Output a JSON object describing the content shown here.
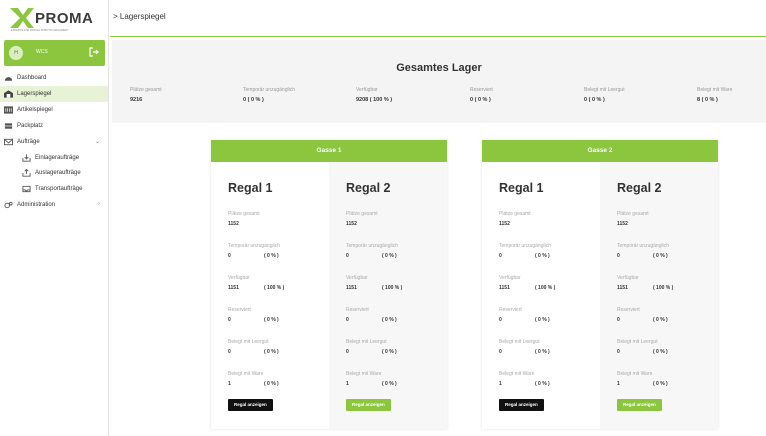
{
  "brand": {
    "logo_text": "XPROMA",
    "tagline": "EXPERTS FOR PARCEL ROBOTIC MACHINERY",
    "accent": "#8cc63f"
  },
  "user": {
    "avatar_initials": "H",
    "name": "WCS"
  },
  "nav": [
    {
      "label": "Dashboard",
      "icon": "dashboard-icon"
    },
    {
      "label": "Lagerspiegel",
      "icon": "warehouse-icon",
      "active": true
    },
    {
      "label": "Artikelspiegel",
      "icon": "barcode-icon"
    },
    {
      "label": "Packplatz",
      "icon": "box-icon"
    },
    {
      "label": "Aufträge",
      "icon": "mail-icon",
      "chevron": "⌄"
    },
    {
      "label": "Einlageraufträge",
      "icon": "inbox-in-icon",
      "sub": true
    },
    {
      "label": "Auslageraufträge",
      "icon": "inbox-out-icon",
      "sub": true
    },
    {
      "label": "Transportaufträge",
      "icon": "tray-icon",
      "sub": true
    },
    {
      "label": "Administration",
      "icon": "gears-icon",
      "chevron": "›"
    }
  ],
  "breadcrumb": "> Lagerspiegel",
  "summary": {
    "title": "Gesamtes Lager",
    "stats": [
      {
        "label": "Plätze gesamt",
        "value": "9216"
      },
      {
        "label": "Temporär unzugänglich",
        "value": "0  ( 0 % )"
      },
      {
        "label": "Verfügbar",
        "value": "9208  ( 100 % )"
      },
      {
        "label": "Reserviert",
        "value": "0  ( 0 % )"
      },
      {
        "label": "Belegt mit Leergut",
        "value": "0  ( 0 % )"
      },
      {
        "label": "Belegt mit Ware",
        "value": "8  ( 0 % )"
      }
    ]
  },
  "gassen": [
    {
      "title": "Gasse 1",
      "regale": [
        {
          "title": "Regal 1",
          "button": "Regal anzeigen",
          "fields": [
            {
              "label": "Plätze gesamt",
              "value": "1152",
              "pct": ""
            },
            {
              "label": "Temporär unzugänglich",
              "value": "0",
              "pct": "( 0 % )"
            },
            {
              "label": "Verfügbar",
              "value": "1151",
              "pct": "( 100 % )"
            },
            {
              "label": "Reserviert",
              "value": "0",
              "pct": "( 0 % )"
            },
            {
              "label": "Belegt mit Leergut",
              "value": "0",
              "pct": "( 0 % )"
            },
            {
              "label": "Belegt mit Ware",
              "value": "1",
              "pct": "( 0 % )"
            }
          ]
        },
        {
          "title": "Regal 2",
          "button": "Regal anzeigen",
          "fields": [
            {
              "label": "Plätze gesamt",
              "value": "1152",
              "pct": ""
            },
            {
              "label": "Temporär unzugänglich",
              "value": "0",
              "pct": "( 0 % )"
            },
            {
              "label": "Verfügbar",
              "value": "1151",
              "pct": "( 100 % )"
            },
            {
              "label": "Reserviert",
              "value": "0",
              "pct": "( 0 % )"
            },
            {
              "label": "Belegt mit Leergut",
              "value": "0",
              "pct": "( 0 % )"
            },
            {
              "label": "Belegt mit Ware",
              "value": "1",
              "pct": "( 0 % )"
            }
          ]
        }
      ]
    },
    {
      "title": "Gasse 2",
      "regale": [
        {
          "title": "Regal 1",
          "button": "Regal anzeigen",
          "fields": [
            {
              "label": "Plätze gesamt",
              "value": "1152",
              "pct": ""
            },
            {
              "label": "Temporär unzugänglich",
              "value": "0",
              "pct": "( 0 % )"
            },
            {
              "label": "Verfügbar",
              "value": "1151",
              "pct": "( 100 % )"
            },
            {
              "label": "Reserviert",
              "value": "0",
              "pct": "( 0 % )"
            },
            {
              "label": "Belegt mit Leergut",
              "value": "0",
              "pct": "( 0 % )"
            },
            {
              "label": "Belegt mit Ware",
              "value": "1",
              "pct": "( 0 % )"
            }
          ]
        },
        {
          "title": "Regal 2",
          "button": "Regal anzeigen",
          "fields": [
            {
              "label": "Plätze gesamt",
              "value": "1152",
              "pct": ""
            },
            {
              "label": "Temporär unzugänglich",
              "value": "0",
              "pct": "( 0 % )"
            },
            {
              "label": "Verfügbar",
              "value": "1151",
              "pct": "( 100 % )"
            },
            {
              "label": "Reserviert",
              "value": "0",
              "pct": "( 0 % )"
            },
            {
              "label": "Belegt mit Leergut",
              "value": "0",
              "pct": "( 0 % )"
            },
            {
              "label": "Belegt mit Ware",
              "value": "1",
              "pct": "( 0 % )"
            }
          ]
        }
      ]
    }
  ]
}
